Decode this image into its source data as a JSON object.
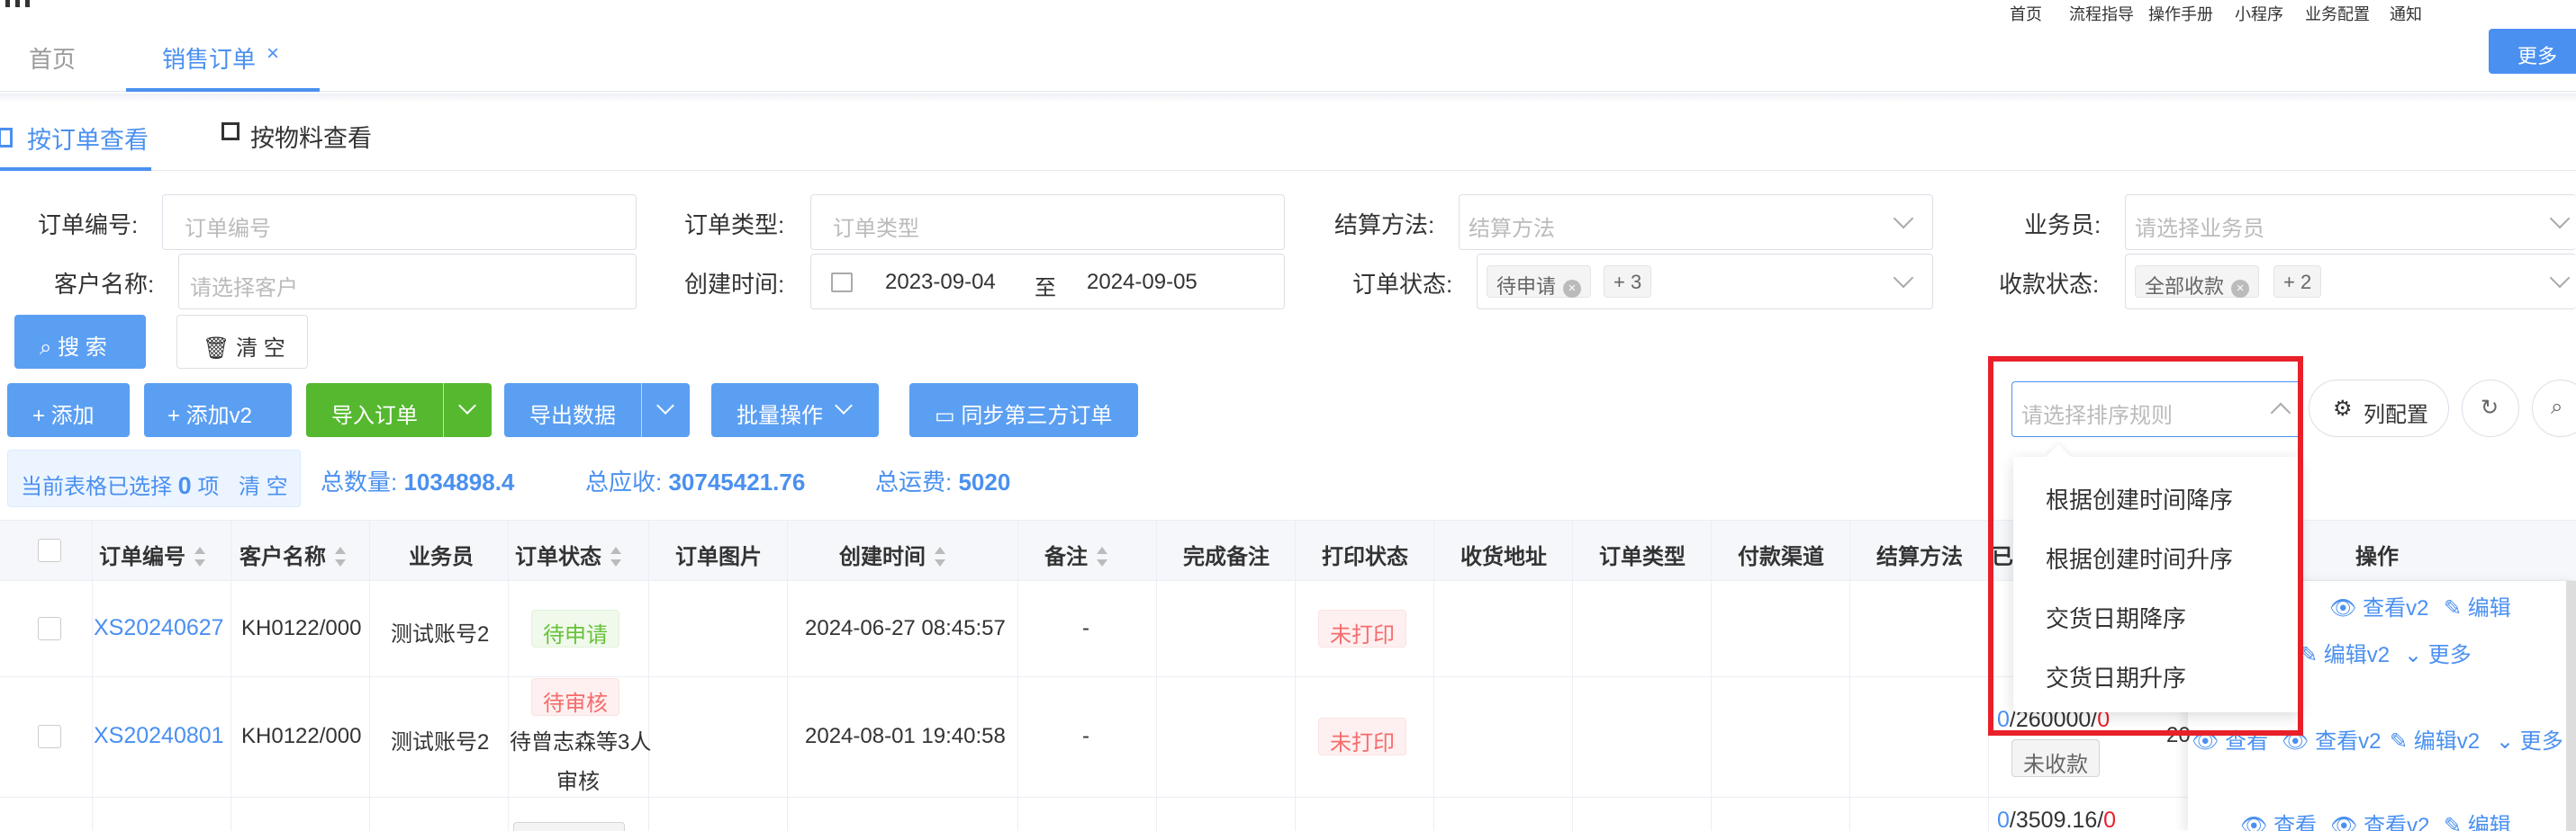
{
  "header": {
    "links": [
      "首页",
      "流程指导",
      "操作手册",
      "小程序",
      "业务配置",
      "通知"
    ],
    "more_label": "更多"
  },
  "tabs": {
    "home": "首页",
    "active": "销售订单",
    "close": "×"
  },
  "view_tabs": {
    "by_order": "按订单查看",
    "by_material": "按物料查看"
  },
  "filters": {
    "order_no": {
      "label": "订单编号:",
      "placeholder": "订单编号"
    },
    "order_type": {
      "label": "订单类型:",
      "placeholder": "订单类型"
    },
    "settle": {
      "label": "结算方法:",
      "placeholder": "结算方法"
    },
    "salesman": {
      "label": "业务员:",
      "placeholder": "请选择业务员"
    },
    "customer": {
      "label": "客户名称:",
      "placeholder": "请选择客户"
    },
    "created": {
      "label": "创建时间:",
      "from": "2023-09-04",
      "sep": "至",
      "to": "2024-09-05"
    },
    "status": {
      "label": "订单状态:",
      "tag": "待申请",
      "more": "+ 3"
    },
    "payment": {
      "label": "收款状态:",
      "tag": "全部收款",
      "more": "+ 2"
    }
  },
  "actions": {
    "search": "搜 索",
    "clear": "清 空",
    "add": "+ 添加",
    "add_v2": "+ 添加v2",
    "import": "导入订单",
    "export": "导出数据",
    "batch": "批量操作",
    "sync": "同步第三方订单",
    "column_config": "列配置"
  },
  "sort": {
    "placeholder": "请选择排序规则",
    "options": [
      "根据创建时间降序",
      "根据创建时间升序",
      "交货日期降序",
      "交货日期升序"
    ]
  },
  "summary": {
    "selected_prefix": "当前表格已选择",
    "selected_count": "0",
    "selected_suffix": "项",
    "clear": "清 空",
    "total_qty_label": "总数量:",
    "total_qty": "1034898.4",
    "total_receivable_label": "总应收:",
    "total_receivable": "30745421.76",
    "total_freight_label": "总运费:",
    "total_freight": "5020"
  },
  "table": {
    "columns": [
      "订单编号",
      "客户名称",
      "业务员",
      "订单状态",
      "订单图片",
      "创建时间",
      "备注",
      "完成备注",
      "打印状态",
      "收货地址",
      "订单类型",
      "付款渠道",
      "结算方法",
      "已",
      "操作"
    ],
    "rows": [
      {
        "order_no": "XS20240627",
        "customer": "KH0122/000",
        "salesman": "测试账号2",
        "status": "待申请",
        "created": "2024-06-27 08:45:57",
        "remark": "-",
        "print": "未打印"
      },
      {
        "order_no": "XS20240801",
        "customer": "KH0122/000",
        "salesman": "测试账号2",
        "status": "待审核",
        "status_note1": "待曾志森等3人",
        "status_note2": "审核",
        "created": "2024-08-01 19:40:58",
        "remark": "-",
        "print": "未打印",
        "paid_a": "0",
        "paid_b": "/260000/",
        "paid_c": "0",
        "pay_badge": "未收款",
        "qty": "20"
      },
      {
        "paid_a": "0",
        "paid_b": "/3509.16/",
        "paid_c": "0"
      }
    ],
    "ops": {
      "view": "查看",
      "view_v2": "查看v2",
      "edit": "编辑",
      "edit_v2": "编辑v2",
      "more": "更多"
    }
  },
  "colors": {
    "primary": "#4a90f0",
    "green": "#55b82f",
    "highlight": "#e8202a"
  }
}
